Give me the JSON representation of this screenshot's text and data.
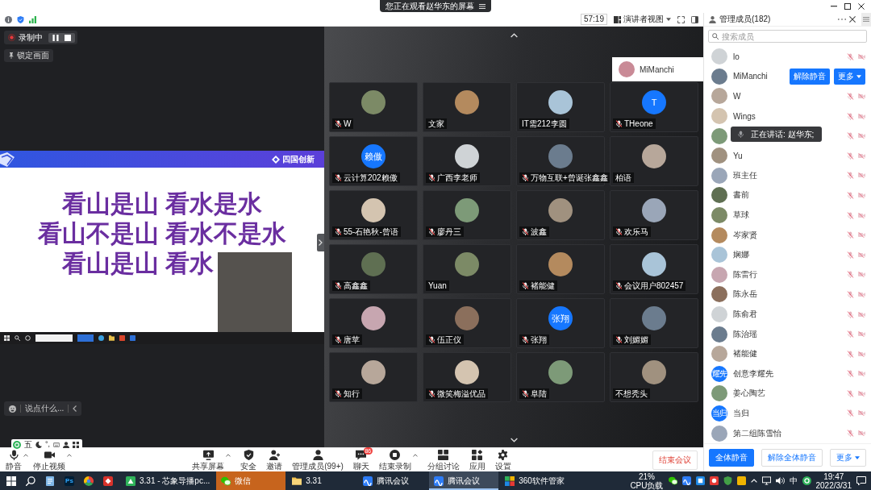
{
  "title_bar": {
    "notice": "您正在观看赵华东的屏幕"
  },
  "info_bar": {
    "timer": "57:19",
    "view": "演讲者视图"
  },
  "recording": {
    "status": "录制中",
    "lock": "锁定画面"
  },
  "slide": {
    "brand": "四国创新",
    "lines": [
      "看山是山 看水是水",
      "看山不是山 看水不是水",
      "看山是山 看水"
    ]
  },
  "chat": {
    "placeholder": "说点什么..."
  },
  "video_grid": {
    "floating": {
      "name": "MiManchi"
    },
    "tiles": [
      {
        "name": "W",
        "muted": true
      },
      {
        "name": "文家",
        "muted": false
      },
      {
        "name": "IT需212李圆",
        "muted": false
      },
      {
        "name": "THeone",
        "muted": true,
        "avatar_text": "T"
      },
      {
        "name": "云计算202赖傲",
        "muted": true,
        "avatar_text": "赖傲"
      },
      {
        "name": "广西李老师",
        "muted": true
      },
      {
        "name": "万物互联+曾诞张鑫鑫",
        "muted": true
      },
      {
        "name": "柏语",
        "muted": false
      },
      {
        "name": "55-石艳秋-曾语",
        "muted": true
      },
      {
        "name": "廖丹三",
        "muted": true
      },
      {
        "name": "波鑫",
        "muted": true
      },
      {
        "name": "欢乐马",
        "muted": true
      },
      {
        "name": "高鑫鑫",
        "muted": true
      },
      {
        "name": "Yuan",
        "muted": false
      },
      {
        "name": "褚能健",
        "muted": true
      },
      {
        "name": "会议用户802457",
        "muted": true
      },
      {
        "name": "唐苹",
        "muted": true
      },
      {
        "name": "伍正仪",
        "muted": true
      },
      {
        "name": "张翔",
        "muted": true,
        "avatar_text": "张翔"
      },
      {
        "name": "刘媚媚",
        "muted": true
      },
      {
        "name": "知行",
        "muted": true
      },
      {
        "name": "微笑梅溢优品",
        "muted": true
      },
      {
        "name": "阜陆",
        "muted": true
      },
      {
        "name": "不想秃头",
        "muted": false
      }
    ]
  },
  "ime_bar": {
    "mode": "五",
    "punctuation": "°,"
  },
  "toolbar": {
    "media": [
      {
        "label": "静音",
        "menu": true
      },
      {
        "label": "停止视频",
        "menu": true
      }
    ],
    "items": [
      {
        "label": "共享屏幕",
        "menu": true
      },
      {
        "label": "安全",
        "menu": false
      },
      {
        "label": "邀请",
        "menu": false
      },
      {
        "label": "管理成员(99+)",
        "menu": false
      },
      {
        "label": "聊天",
        "menu": false,
        "badge": "86"
      },
      {
        "label": "结束录制",
        "menu": true
      },
      {
        "label": "分组讨论",
        "menu": false
      },
      {
        "label": "应用",
        "menu": false
      },
      {
        "label": "设置",
        "menu": false
      }
    ],
    "end_button": "结束会议"
  },
  "members": {
    "title": "管理成员(182)",
    "search": {
      "placeholder": "搜索成员"
    },
    "rows": [
      {
        "name": "lo",
        "kind": "status",
        "muted": true,
        "video_off": true
      },
      {
        "name": "MiManchi",
        "kind": "actions",
        "actions": [
          {
            "label": "解除静音",
            "menu": false
          },
          {
            "label": "更多",
            "menu": true
          }
        ]
      },
      {
        "name": "W",
        "kind": "status",
        "muted": true,
        "video_off": true
      },
      {
        "name": "Wings",
        "kind": "status",
        "muted": true,
        "video_off": true
      },
      {
        "kind": "status",
        "muted": true,
        "video_off": true
      },
      {
        "name": "Yu",
        "kind": "status",
        "muted": true,
        "video_off": true
      },
      {
        "name": "班主任",
        "kind": "status",
        "muted": true,
        "video_off": true
      },
      {
        "name": "書前",
        "kind": "status",
        "muted": true,
        "video_off": true
      },
      {
        "name": "草球",
        "kind": "status",
        "muted": true,
        "video_off": true
      },
      {
        "name": "岑家贤",
        "kind": "status",
        "muted": true,
        "video_off": true
      },
      {
        "name": "娴娜",
        "kind": "status",
        "muted": true,
        "video_off": true
      },
      {
        "name": "陈雷行",
        "kind": "status",
        "muted": true,
        "video_off": true
      },
      {
        "name": "陈永岳",
        "kind": "status",
        "muted": true,
        "video_off": true
      },
      {
        "name": "陈俞君",
        "kind": "status",
        "muted": true,
        "video_off": true
      },
      {
        "name": "陈治瑶",
        "kind": "status",
        "muted": true,
        "video_off": true
      },
      {
        "name": "褚能健",
        "kind": "status",
        "muted": true,
        "video_off": true
      },
      {
        "name": "创意李耀先",
        "kind": "status",
        "muted": true,
        "video_off": true,
        "avatar_text": "耀先"
      },
      {
        "name": "姜心陶艺",
        "kind": "status",
        "muted": true,
        "video_off": true
      },
      {
        "name": "当归",
        "kind": "status",
        "muted": true,
        "video_off": true,
        "avatar_text": "当归"
      },
      {
        "name": "第二组陈雪怡",
        "kind": "status",
        "muted": true,
        "video_off": true
      }
    ],
    "speaking": "正在讲话: 赵华东;",
    "buttons": [
      {
        "label": "全体静音",
        "primary": true,
        "menu": false
      },
      {
        "label": "解除全体静音",
        "primary": false,
        "menu": false
      },
      {
        "label": "更多",
        "primary": false,
        "menu": true
      }
    ]
  },
  "taskbar": {
    "pinned_text": "Ps",
    "apps": [
      {
        "label": "3.31 - 芯象导播pc...",
        "selected": false,
        "flashing": false
      },
      {
        "label": "微信",
        "selected": false,
        "flashing": true
      },
      {
        "label": "3.31",
        "selected": false,
        "flashing": false
      },
      {
        "label": "腾讯会议",
        "selected": false,
        "flashing": false
      },
      {
        "label": "腾讯会议",
        "selected": true,
        "flashing": false
      },
      {
        "label": "360软件管家",
        "selected": false,
        "flashing": false
      }
    ],
    "cpu": "21%",
    "cpu_label": "CPU负载",
    "ime": "中",
    "time": "19:47",
    "date": "2022/3/31"
  }
}
